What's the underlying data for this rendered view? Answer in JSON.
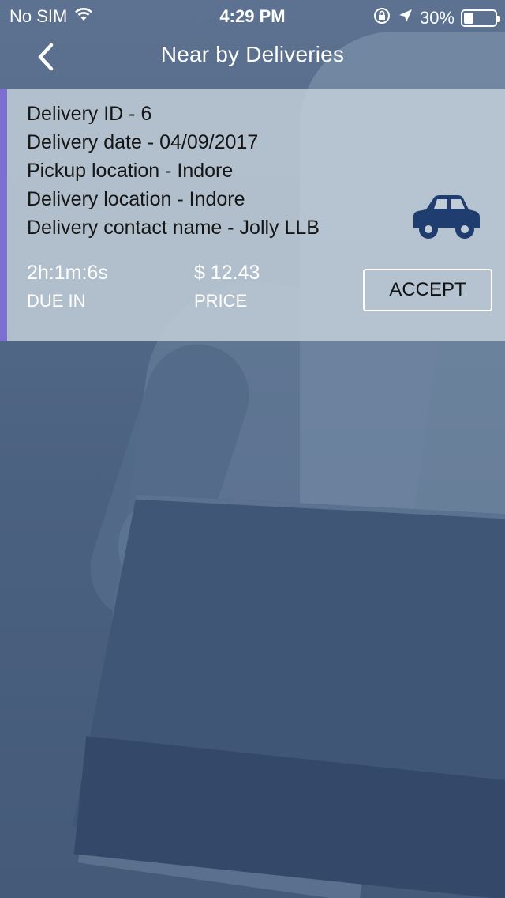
{
  "status_bar": {
    "carrier": "No SIM",
    "time": "4:29 PM",
    "battery_percent": "30%",
    "battery_level": 0.3,
    "icons": [
      "wifi-icon",
      "orientation-lock-icon",
      "location-arrow-icon",
      "battery-icon"
    ]
  },
  "nav": {
    "title": "Near by Deliveries",
    "back_icon": "chevron-left-icon"
  },
  "delivery": {
    "id_line": "Delivery ID - 6",
    "date_line": "Delivery date - 04/09/2017",
    "pickup_line": "Pickup location - Indore",
    "delivery_line": "Delivery location - Indore",
    "contact_line": "Delivery contact name - Jolly LLB",
    "due_in_value": "2h:1m:6s",
    "due_in_label": "DUE IN",
    "price_value": "$ 12.43",
    "price_label": "PRICE",
    "accept_label": "ACCEPT",
    "vehicle_icon": "car-icon"
  },
  "colors": {
    "card_accent": "#7b6fd0",
    "car_icon": "#1f3d6e",
    "background": "#4f6684"
  }
}
